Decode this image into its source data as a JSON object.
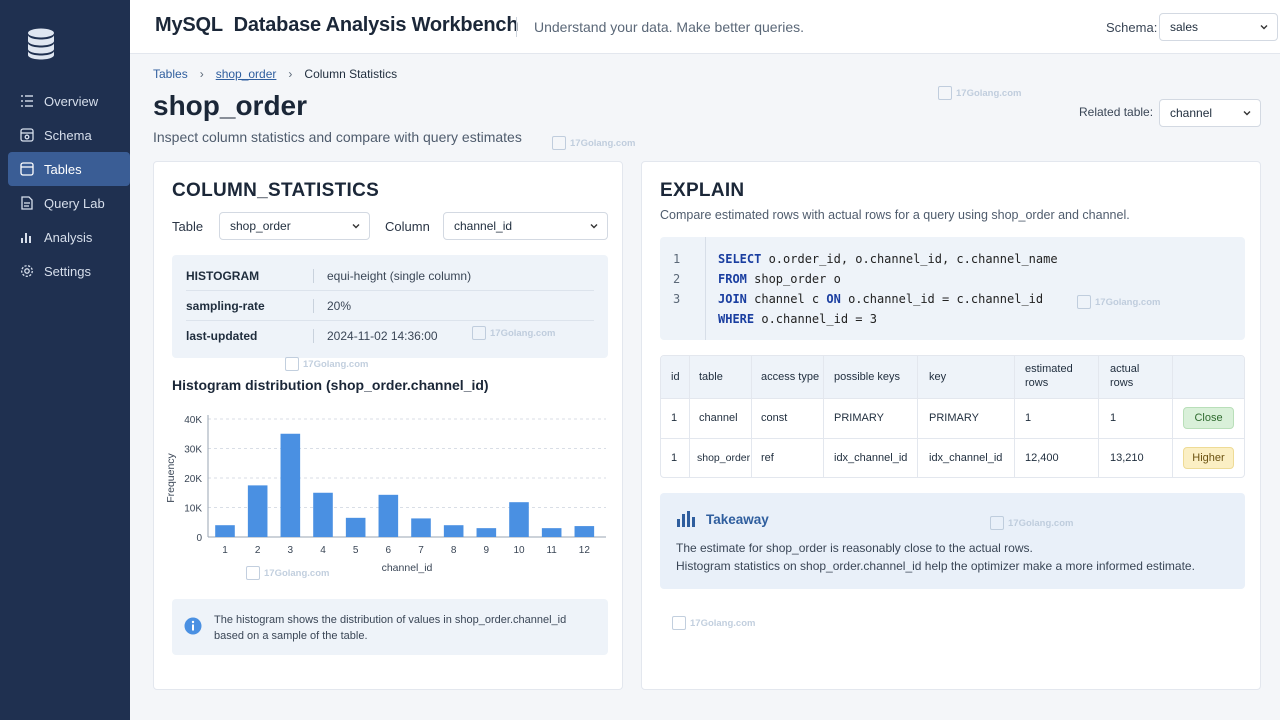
{
  "header": {
    "title_brand": "MySQL",
    "title_rest": "Database Analysis Workbench",
    "tagline": "Understand your data. Make better queries.",
    "schema_label": "Schema:",
    "schema_value": "sales"
  },
  "sidebar": {
    "items": [
      {
        "label": "Overview",
        "icon": "list-icon"
      },
      {
        "label": "Schema",
        "icon": "schema-icon"
      },
      {
        "label": "Tables",
        "icon": "table-icon",
        "active": true
      },
      {
        "label": "Query Lab",
        "icon": "document-icon"
      },
      {
        "label": "Analysis",
        "icon": "bar-chart-icon"
      },
      {
        "label": "Settings",
        "icon": "gear-icon"
      }
    ]
  },
  "breadcrumb": {
    "items": [
      "Tables",
      "shop_order",
      "Column Statistics"
    ]
  },
  "page": {
    "title": "shop_order",
    "subtitle": "Inspect column statistics and compare with query estimates",
    "related_label": "Related table:",
    "related_value": "channel"
  },
  "column_stats": {
    "title": "COLUMN_STATISTICS",
    "table_label": "Table",
    "table_value": "shop_order",
    "column_label": "Column",
    "column_value": "channel_id",
    "rows": [
      {
        "key": "HISTOGRAM",
        "value": "equi-height (single column)"
      },
      {
        "key": "sampling-rate",
        "value": "20%"
      },
      {
        "key": "last-updated",
        "value": "2024-11-02 14:36:00"
      }
    ],
    "histogram_title": "Histogram distribution (shop_order.channel_id)",
    "info": "The histogram shows the distribution of values in shop_order.channel_id based on a sample of the table."
  },
  "chart_data": {
    "type": "bar",
    "categories": [
      "1",
      "2",
      "3",
      "4",
      "5",
      "6",
      "7",
      "8",
      "9",
      "10",
      "11",
      "12"
    ],
    "values": [
      4000,
      17500,
      35000,
      15000,
      6500,
      14300,
      6300,
      4000,
      3000,
      11800,
      3000,
      3700
    ],
    "yticks": [
      "0",
      "10K",
      "20K",
      "30K",
      "40K"
    ],
    "ylim": [
      0,
      40000
    ],
    "xlabel": "channel_id",
    "ylabel": "Frequency",
    "grid": true,
    "bar_color": "#4a90e2"
  },
  "explain": {
    "title": "EXPLAIN",
    "subtitle": "Compare estimated rows with actual rows for a query using shop_order and channel.",
    "code_lines": [
      {
        "n": "1",
        "parts": [
          [
            "kw",
            "SELECT"
          ],
          [
            "tx",
            " o.order_id, o.channel_id, c.channel_name"
          ]
        ]
      },
      {
        "n": "2",
        "parts": [
          [
            "kw",
            "FROM"
          ],
          [
            "tx",
            " shop_order o"
          ]
        ]
      },
      {
        "n": "3",
        "parts": [
          [
            "kw",
            "JOIN"
          ],
          [
            "tx",
            " channel c "
          ],
          [
            "kw",
            "ON"
          ],
          [
            "tx",
            " o.channel_id = c.channel_id"
          ]
        ]
      },
      {
        "n": "",
        "parts": [
          [
            "kw",
            "WHERE"
          ],
          [
            "tx",
            " o.channel_id = 3"
          ]
        ]
      }
    ],
    "columns": [
      "id",
      "table",
      "access type",
      "possible keys",
      "key",
      "estimated rows",
      "actual rows",
      ""
    ],
    "rows": [
      {
        "id": "1",
        "table": "channel",
        "access": "const",
        "possible": "PRIMARY",
        "key": "PRIMARY",
        "est": "1",
        "act": "1",
        "badge": "Close"
      },
      {
        "id": "1",
        "table": "shop_order",
        "access": "ref",
        "possible": "idx_channel_id",
        "key": "idx_channel_id",
        "est": "12,400",
        "act": "13,210",
        "badge": "Higher"
      }
    ]
  },
  "takeaway": {
    "title": "Takeaway",
    "line1": "The estimate for shop_order is reasonably close to the actual rows.",
    "line2": "Histogram statistics on shop_order.channel_id help the optimizer make a more informed estimate."
  },
  "watermark": "17Golang.com",
  "colors": {
    "sidebar": "#1f3050",
    "active": "#3a5d95",
    "accent": "#2f5e9e",
    "bar": "#4a90e2"
  }
}
